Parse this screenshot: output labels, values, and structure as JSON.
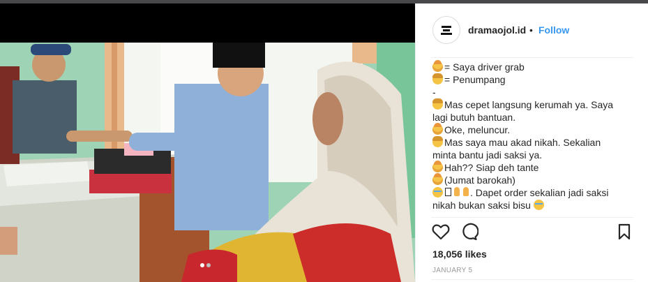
{
  "post": {
    "username": "dramaojol.id",
    "separator": "•",
    "follow_label": "Follow",
    "avatar_logo": "DRAMA OJOL INDONESIA",
    "caption_lines": [
      {
        "emoji": "driver",
        "text": "= Saya driver grab"
      },
      {
        "emoji": "passenger",
        "text": "= Penumpang"
      },
      {
        "emoji": "",
        "text": "-"
      },
      {
        "emoji": "passenger",
        "text": "Mas cepet langsung kerumah ya. Saya"
      },
      {
        "emoji": "",
        "text": "lagi butuh bantuan."
      },
      {
        "emoji": "driver",
        "text": "Oke, meluncur."
      },
      {
        "emoji": "passenger",
        "text": "Mas saya mau akad nikah. Sekalian"
      },
      {
        "emoji": "",
        "text": "minta bantu jadi saksi ya."
      },
      {
        "emoji": "driver",
        "text": "Hah?? Siap deh tante"
      },
      {
        "emoji": "driver",
        "text": "(Jumat barokah)"
      },
      {
        "emoji": "cry-box-pray",
        "text": ". Dapet order sekalian jadi saksi"
      },
      {
        "emoji": "",
        "text": "nikah bukan saksi bisu"
      }
    ],
    "likes": "18,056 likes",
    "date": "JANUARY 5"
  },
  "icons": {
    "like": "heart-icon",
    "comment": "comment-icon",
    "save": "bookmark-icon"
  },
  "carousel": {
    "total": 2,
    "active": 1
  }
}
